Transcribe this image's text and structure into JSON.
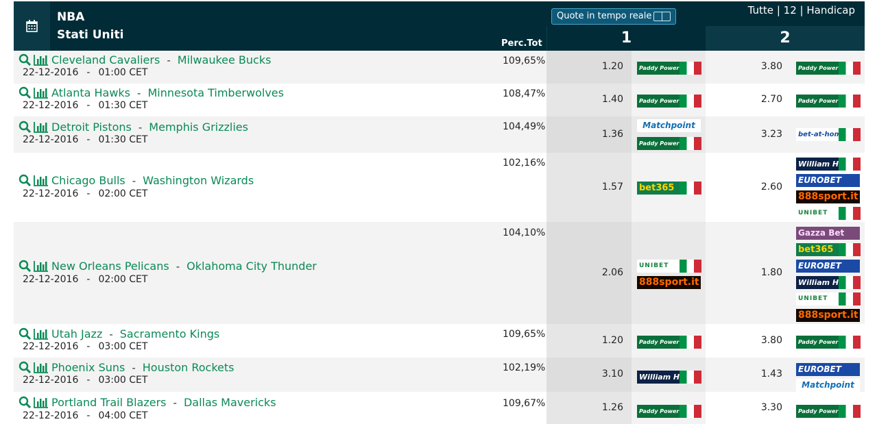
{
  "header": {
    "league": "NBA",
    "country": "Stati Uniti",
    "perc_label": "Perc.Tot",
    "live_label": "Quote in tempo reale",
    "filters": [
      "Tutte",
      "12",
      "Handicap"
    ],
    "col1": "1",
    "col2": "2"
  },
  "rows": [
    {
      "home": "Cleveland Cavaliers",
      "away": "Milwaukee Bucks",
      "date": "22-12-2016",
      "time": "01:00 CET",
      "perc": "109,65%",
      "odd1": "1.20",
      "odd2": "3.80",
      "books1": [
        "Paddy Power"
      ],
      "books2": [
        "Paddy Power"
      ]
    },
    {
      "home": "Atlanta Hawks",
      "away": "Minnesota Timberwolves",
      "date": "22-12-2016",
      "time": "01:30 CET",
      "perc": "108,47%",
      "odd1": "1.40",
      "odd2": "2.70",
      "books1": [
        "Paddy Power"
      ],
      "books2": [
        "Paddy Power"
      ]
    },
    {
      "home": "Detroit Pistons",
      "away": "Memphis Grizzlies",
      "date": "22-12-2016",
      "time": "01:30 CET",
      "perc": "104,49%",
      "odd1": "1.36",
      "odd2": "3.23",
      "books1": [
        "Matchpoint",
        "Paddy Power"
      ],
      "books2": [
        "bet-at-home"
      ]
    },
    {
      "home": "Chicago Bulls",
      "away": "Washington Wizards",
      "date": "22-12-2016",
      "time": "02:00 CET",
      "perc": "102,16%",
      "odd1": "1.57",
      "odd2": "2.60",
      "books1": [
        "bet365"
      ],
      "books2": [
        "William HILL",
        "EUROBET",
        "888sport.it",
        "UNIBET"
      ]
    },
    {
      "home": "New Orleans Pelicans",
      "away": "Oklahoma City Thunder",
      "date": "22-12-2016",
      "time": "02:00 CET",
      "perc": "104,10%",
      "odd1": "2.06",
      "odd2": "1.80",
      "books1": [
        "UNIBET",
        "888sport.it"
      ],
      "books2": [
        "Gazza Bet",
        "bet365",
        "EUROBET",
        "William HILL",
        "UNIBET",
        "888sport.it"
      ]
    },
    {
      "home": "Utah Jazz",
      "away": "Sacramento Kings",
      "date": "22-12-2016",
      "time": "03:00 CET",
      "perc": "109,65%",
      "odd1": "1.20",
      "odd2": "3.80",
      "books1": [
        "Paddy Power"
      ],
      "books2": [
        "Paddy Power"
      ]
    },
    {
      "home": "Phoenix Suns",
      "away": "Houston Rockets",
      "date": "22-12-2016",
      "time": "03:00 CET",
      "perc": "102,19%",
      "odd1": "3.10",
      "odd2": "1.43",
      "books1": [
        "William HILL"
      ],
      "books2": [
        "EUROBET",
        "Matchpoint"
      ]
    },
    {
      "home": "Portland Trail Blazers",
      "away": "Dallas Mavericks",
      "date": "22-12-2016",
      "time": "04:00 CET",
      "perc": "109,67%",
      "odd1": "1.26",
      "odd2": "3.30",
      "books1": [
        "Paddy Power"
      ],
      "books2": [
        "Paddy Power"
      ]
    }
  ],
  "icons": {
    "calendar": "calendar-icon",
    "search": "search-icon",
    "stats": "bar-chart-icon"
  },
  "colors": {
    "header": "#012b36",
    "team_link": "#0a8a55",
    "live_button": "#0f5978"
  }
}
